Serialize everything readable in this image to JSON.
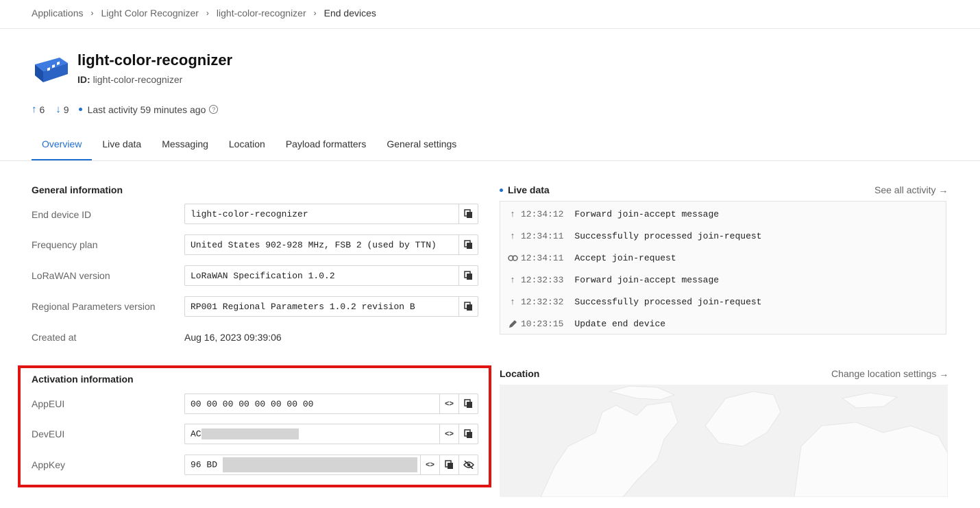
{
  "breadcrumb": [
    "Applications",
    "Light Color Recognizer",
    "light-color-recognizer",
    "End devices"
  ],
  "device": {
    "title": "light-color-recognizer",
    "id_label": "ID:",
    "id_value": "light-color-recognizer",
    "uplink_count": "6",
    "downlink_count": "9",
    "last_activity": "Last activity 59 minutes ago"
  },
  "tabs": [
    "Overview",
    "Live data",
    "Messaging",
    "Location",
    "Payload formatters",
    "General settings"
  ],
  "general": {
    "title": "General information",
    "fields": [
      {
        "label": "End device ID",
        "value": "light-color-recognizer"
      },
      {
        "label": "Frequency plan",
        "value": "United States 902-928 MHz, FSB 2 (used by TTN)"
      },
      {
        "label": "LoRaWAN version",
        "value": "LoRaWAN Specification 1.0.2"
      },
      {
        "label": "Regional Parameters version",
        "value": "RP001 Regional Parameters 1.0.2 revision B"
      }
    ],
    "created_label": "Created at",
    "created_value": "Aug 16, 2023 09:39:06"
  },
  "activation": {
    "title": "Activation information",
    "fields": [
      {
        "label": "AppEUI",
        "value": "00 00 00 00 00 00 00 00"
      },
      {
        "label": "DevEUI",
        "value": "AC"
      },
      {
        "label": "AppKey",
        "value": "96 BD"
      }
    ]
  },
  "live_data": {
    "title": "Live data",
    "see_all": "See all activity →",
    "events": [
      {
        "icon": "arrow-up-icon",
        "time": "12:34:12",
        "message": "Forward join-accept message"
      },
      {
        "icon": "arrow-up-icon",
        "time": "12:34:11",
        "message": "Successfully processed join-request"
      },
      {
        "icon": "link-icon",
        "time": "12:34:11",
        "message": "Accept join-request"
      },
      {
        "icon": "arrow-up-icon",
        "time": "12:32:33",
        "message": "Forward join-accept message"
      },
      {
        "icon": "arrow-up-icon",
        "time": "12:32:32",
        "message": "Successfully processed join-request"
      },
      {
        "icon": "pencil-icon",
        "time": "10:23:15",
        "message": "Update end device"
      }
    ]
  },
  "location": {
    "title": "Location",
    "change_link": "Change location settings →"
  },
  "colors": {
    "accent": "#1f6fd1",
    "highlight": "#e11414"
  }
}
